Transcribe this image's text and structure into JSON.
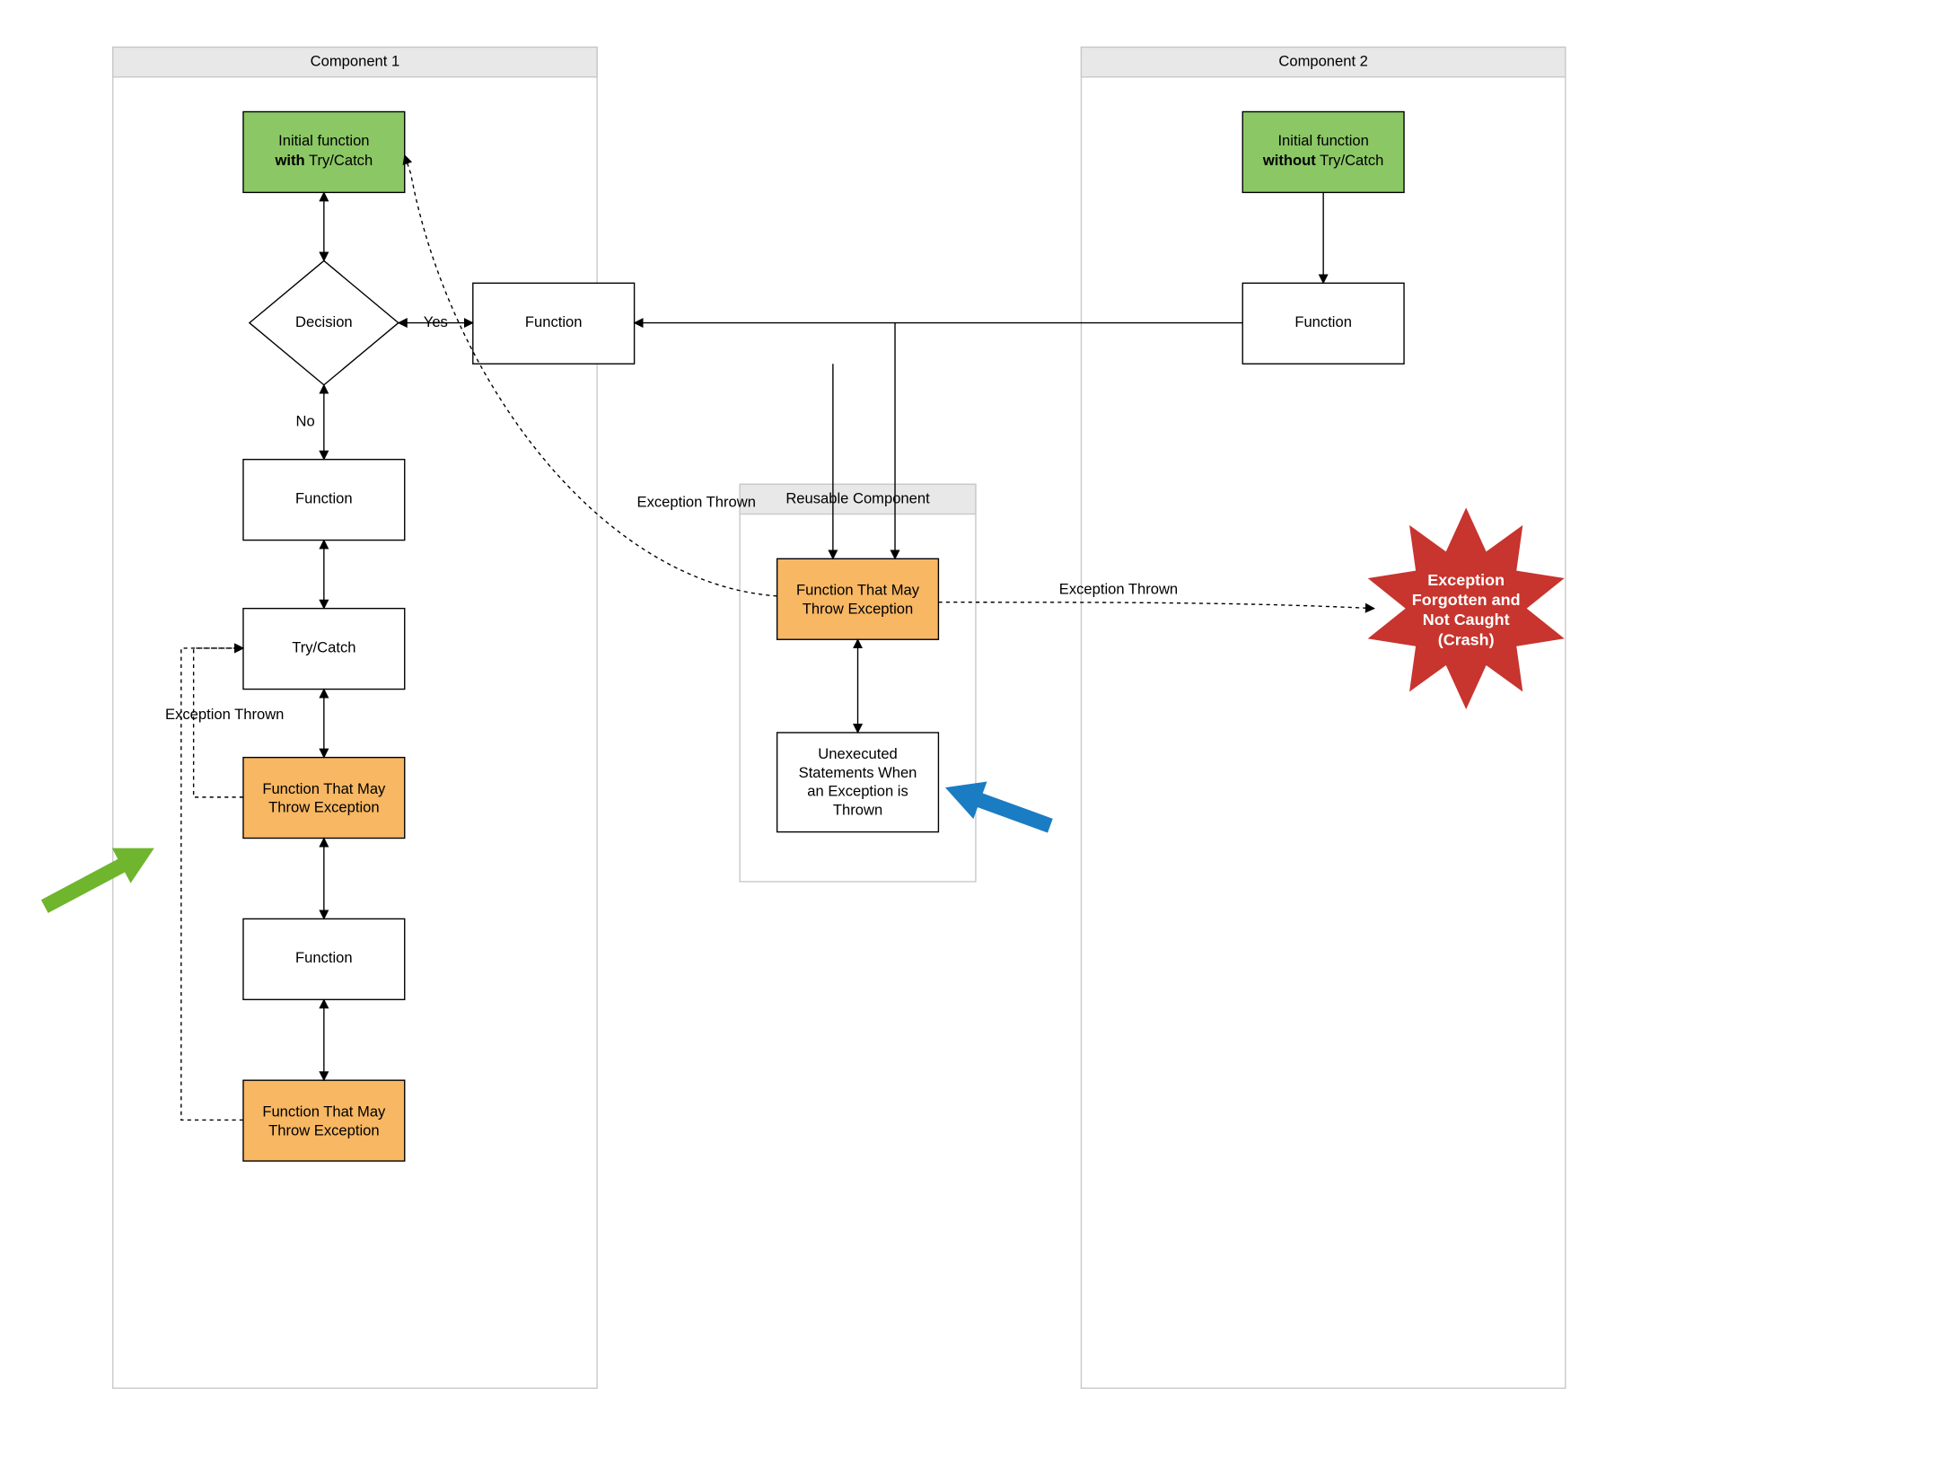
{
  "containers": {
    "comp1": "Component 1",
    "comp2": "Component 2",
    "reusable": "Reusable Component"
  },
  "nodes": {
    "c1_initial_a": "Initial function",
    "c1_initial_b": "with",
    "c1_initial_c": " Try/Catch",
    "c1_decision": "Decision",
    "c1_func_right": "Function",
    "c1_func_below": "Function",
    "c1_try": "Try/Catch",
    "c1_throw1": "Function That May Throw Exception",
    "c1_func4": "Function",
    "c1_throw2": "Function That May Throw Exception",
    "reuse_throw": "Function That May Throw Exception",
    "reuse_unexec": "Unexecuted Statements When an Exception is Thrown",
    "c2_initial_a": "Initial function",
    "c2_initial_b": "without",
    "c2_initial_c": " Try/Catch",
    "c2_func": "Function",
    "burst1": "Exception",
    "burst2": "Forgotten and",
    "burst3": "Not Caught",
    "burst4": "(Crash)"
  },
  "edges": {
    "yes": "Yes",
    "no": "No",
    "exception_thrown_left": "Exception Thrown",
    "exception_thrown_mid": "Exception Thrown",
    "exception_thrown_right": "Exception Thrown"
  },
  "colors": {
    "green": "#8bc765",
    "orange": "#f7b763",
    "red": "#c7352e",
    "containerHead": "#e8e8e8",
    "greenArrow": "#6fb52e",
    "blueArrow": "#1a7cc2"
  },
  "chart_data": {
    "type": "flowchart",
    "containers": [
      {
        "id": "comp1",
        "label": "Component 1"
      },
      {
        "id": "comp2",
        "label": "Component 2"
      },
      {
        "id": "reusable",
        "label": "Reusable Component"
      }
    ],
    "nodes": [
      {
        "id": "c1_initial",
        "container": "comp1",
        "label": "Initial function with Try/Catch",
        "shape": "rect",
        "fill": "green"
      },
      {
        "id": "c1_decision",
        "container": "comp1",
        "label": "Decision",
        "shape": "diamond",
        "fill": "white"
      },
      {
        "id": "c1_func_right",
        "container": "comp1",
        "label": "Function",
        "shape": "rect",
        "fill": "white"
      },
      {
        "id": "c1_func_below",
        "container": "comp1",
        "label": "Function",
        "shape": "rect",
        "fill": "white"
      },
      {
        "id": "c1_try",
        "container": "comp1",
        "label": "Try/Catch",
        "shape": "rect",
        "fill": "white"
      },
      {
        "id": "c1_throw1",
        "container": "comp1",
        "label": "Function That May Throw Exception",
        "shape": "rect",
        "fill": "orange"
      },
      {
        "id": "c1_func4",
        "container": "comp1",
        "label": "Function",
        "shape": "rect",
        "fill": "white"
      },
      {
        "id": "c1_throw2",
        "container": "comp1",
        "label": "Function That May Throw Exception",
        "shape": "rect",
        "fill": "orange"
      },
      {
        "id": "reuse_throw",
        "container": "reusable",
        "label": "Function That May Throw Exception",
        "shape": "rect",
        "fill": "orange"
      },
      {
        "id": "reuse_unexec",
        "container": "reusable",
        "label": "Unexecuted Statements When an Exception is Thrown",
        "shape": "rect",
        "fill": "white"
      },
      {
        "id": "c2_initial",
        "container": "comp2",
        "label": "Initial function without Try/Catch",
        "shape": "rect",
        "fill": "green"
      },
      {
        "id": "c2_func",
        "container": "comp2",
        "label": "Function",
        "shape": "rect",
        "fill": "white"
      },
      {
        "id": "burst",
        "container": null,
        "label": "Exception Forgotten and Not Caught (Crash)",
        "shape": "burst",
        "fill": "red"
      }
    ],
    "edges": [
      {
        "from": "c1_initial",
        "to": "c1_decision",
        "style": "solid",
        "bidir": true
      },
      {
        "from": "c1_decision",
        "to": "c1_func_right",
        "label": "Yes",
        "style": "solid",
        "bidir": true
      },
      {
        "from": "c1_decision",
        "to": "c1_func_below",
        "label": "No",
        "style": "solid",
        "bidir": true
      },
      {
        "from": "c1_func_below",
        "to": "c1_try",
        "style": "solid",
        "bidir": true
      },
      {
        "from": "c1_try",
        "to": "c1_throw1",
        "style": "solid",
        "bidir": true
      },
      {
        "from": "c1_throw1",
        "to": "c1_func4",
        "style": "solid",
        "bidir": true
      },
      {
        "from": "c1_func4",
        "to": "c1_throw2",
        "style": "solid",
        "bidir": true
      },
      {
        "from": "c1_throw1",
        "to": "c1_try",
        "label": "Exception Thrown",
        "style": "dashed"
      },
      {
        "from": "c1_throw2",
        "to": "c1_try",
        "style": "dashed"
      },
      {
        "from": "c1_func_right",
        "to": "reuse_throw",
        "style": "solid"
      },
      {
        "from": "c2_func",
        "to": "c1_func_right",
        "style": "solid"
      },
      {
        "from": "c2_func",
        "to": "reuse_throw",
        "style": "solid"
      },
      {
        "from": "reuse_throw",
        "to": "reuse_unexec",
        "style": "solid",
        "bidir": true
      },
      {
        "from": "reuse_throw",
        "to": "c1_initial",
        "label": "Exception Thrown",
        "style": "dashed"
      },
      {
        "from": "reuse_throw",
        "to": "burst",
        "label": "Exception Thrown",
        "style": "dashed"
      },
      {
        "from": "c2_initial",
        "to": "c2_func",
        "style": "solid"
      }
    ]
  }
}
